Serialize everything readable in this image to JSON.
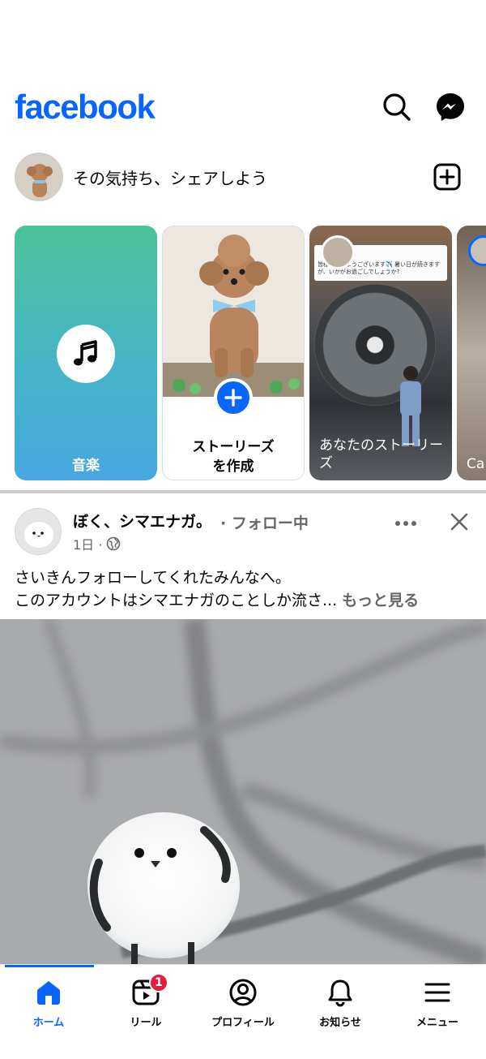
{
  "header": {
    "logo": "facebook"
  },
  "composer": {
    "placeholder": "その気持ち、シェアしよう"
  },
  "stories": {
    "music_label": "音楽",
    "create_label_line1": "ストーリーズ",
    "create_label_line2": "を作成",
    "yours_label": "あなたのストーリーズ",
    "yours_card_text": "皆様、おはようございます✈️ 暑い日が続きますが、いかがお過ごしでしょうか?",
    "next_label": "Ca"
  },
  "post": {
    "author": "ぼく、シマエナガ。",
    "follow_status": "· フォロー中",
    "time": "1日 ·",
    "text_line1": "さいきんフォローしてくれたみんなへ。",
    "text_line2": "このアカウントはシマエナガのことしか流さ...",
    "see_more": "もっと見る"
  },
  "tabbar": {
    "items": [
      {
        "label": "ホーム",
        "icon": "home-icon",
        "active": true
      },
      {
        "label": "リール",
        "icon": "reels-icon",
        "badge": "1"
      },
      {
        "label": "プロフィール",
        "icon": "profile-icon"
      },
      {
        "label": "お知らせ",
        "icon": "bell-icon"
      },
      {
        "label": "メニュー",
        "icon": "menu-icon"
      }
    ]
  },
  "colors": {
    "brand": "#0866ff",
    "badge": "#e41e3f",
    "secondary_text": "#65676b"
  }
}
